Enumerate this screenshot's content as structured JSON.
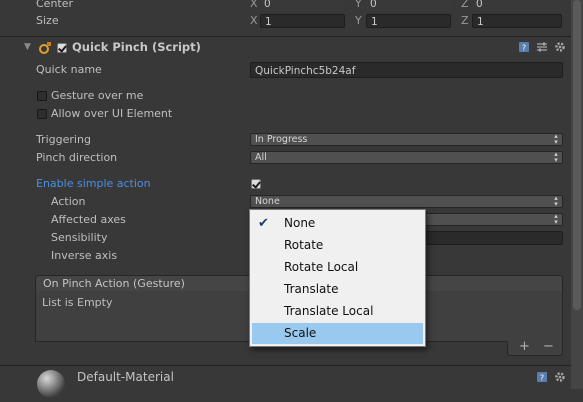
{
  "transform": {
    "center": {
      "label": "Center",
      "x": "0",
      "y": "0",
      "z": "0"
    },
    "size": {
      "label": "Size",
      "x": "1",
      "y": "1",
      "z": "1"
    },
    "axis_labels": {
      "x": "X",
      "y": "Y",
      "z": "Z"
    }
  },
  "component": {
    "title": "Quick Pinch (Script)",
    "quick_name": {
      "label": "Quick name",
      "value": "QuickPinchc5b24af"
    },
    "gesture_over_me": {
      "label": "Gesture over me",
      "checked": false
    },
    "allow_over_ui": {
      "label": "Allow over UI Element",
      "checked": false
    },
    "triggering": {
      "label": "Triggering",
      "value": "In Progress"
    },
    "pinch_direction": {
      "label": "Pinch direction",
      "value": "All"
    },
    "enable_simple_action": {
      "label": "Enable simple action",
      "checked": true
    },
    "action": {
      "label": "Action",
      "value": "None"
    },
    "affected_axes": {
      "label": "Affected axes"
    },
    "sensibility": {
      "label": "Sensibility"
    },
    "inverse_axis": {
      "label": "Inverse axis"
    },
    "event_list": {
      "title": "On Pinch Action (Gesture)",
      "empty_text": "List is Empty",
      "add": "+",
      "remove": "−"
    }
  },
  "material": {
    "name": "Default-Material"
  },
  "action_dropdown": {
    "items": [
      {
        "label": "None",
        "checked": true,
        "highlighted": false
      },
      {
        "label": "Rotate",
        "checked": false,
        "highlighted": false
      },
      {
        "label": "Rotate Local",
        "checked": false,
        "highlighted": false
      },
      {
        "label": "Translate",
        "checked": false,
        "highlighted": false
      },
      {
        "label": "Translate Local",
        "checked": false,
        "highlighted": false
      },
      {
        "label": "Scale",
        "checked": false,
        "highlighted": true
      }
    ]
  },
  "colors": {
    "background": "#383838",
    "accent_label": "#4a8fe0",
    "menu_highlight": "#99c9ef"
  },
  "icons": [
    "script-component-icon",
    "book-help-icon",
    "preset-icon",
    "gear-icon",
    "sphere-material-icon"
  ]
}
